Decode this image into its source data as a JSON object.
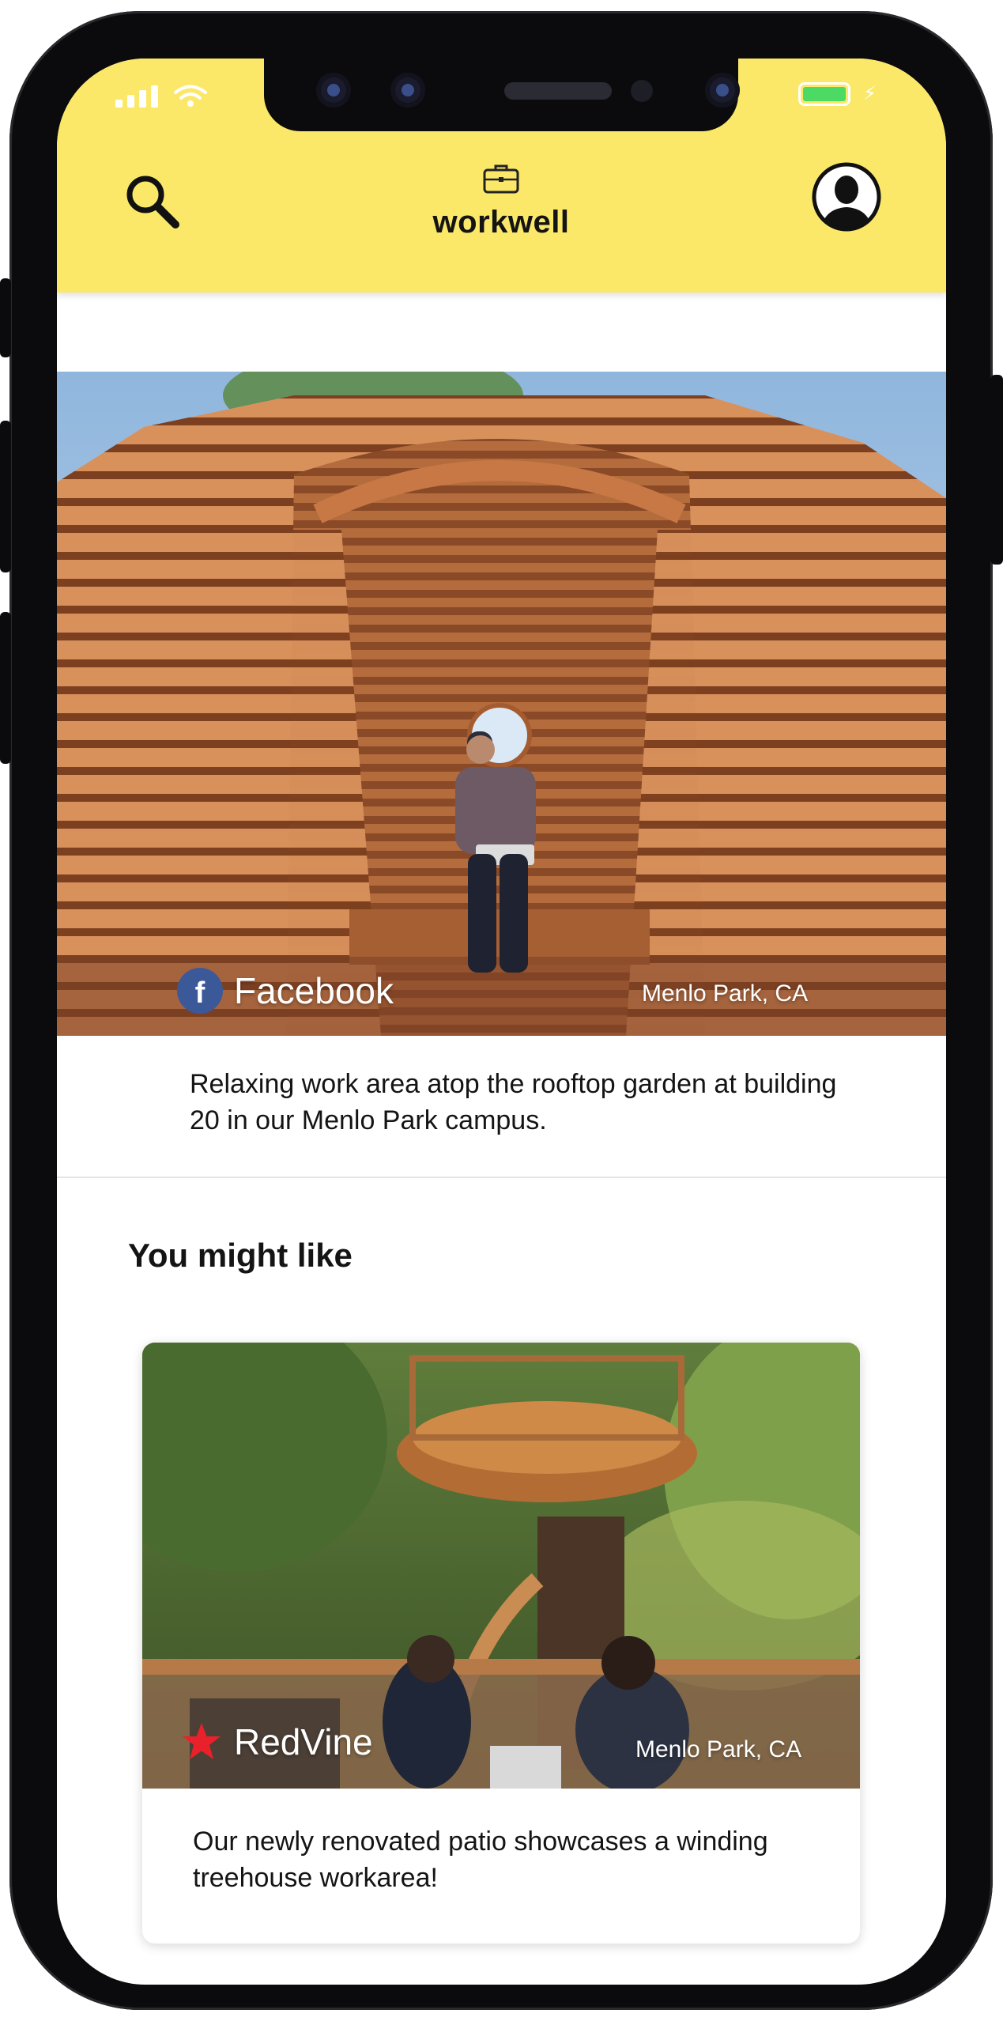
{
  "app": {
    "name": "workwell"
  },
  "header": {
    "search_icon": "search-icon",
    "logo_icon": "briefcase-icon",
    "profile_icon": "user-avatar-icon"
  },
  "status_bar": {
    "battery_color": "#4cd964"
  },
  "featured": {
    "company": "Facebook",
    "location": "Menlo Park, CA",
    "description": "Relaxing work area atop the rooftop garden at building 20 in our Menlo Park campus.",
    "brand_icon": "facebook-logo-icon",
    "brand_color": "#3b5998"
  },
  "recommendations": {
    "title": "You might like",
    "items": [
      {
        "company": "RedVine",
        "location": "Menlo Park, CA",
        "description": "Our newly renovated patio showcases a winding treehouse workarea!",
        "brand_icon": "red-star-icon",
        "brand_color": "#e8212b"
      }
    ]
  },
  "colors": {
    "header_bg": "#fbe869",
    "text": "#141414"
  }
}
